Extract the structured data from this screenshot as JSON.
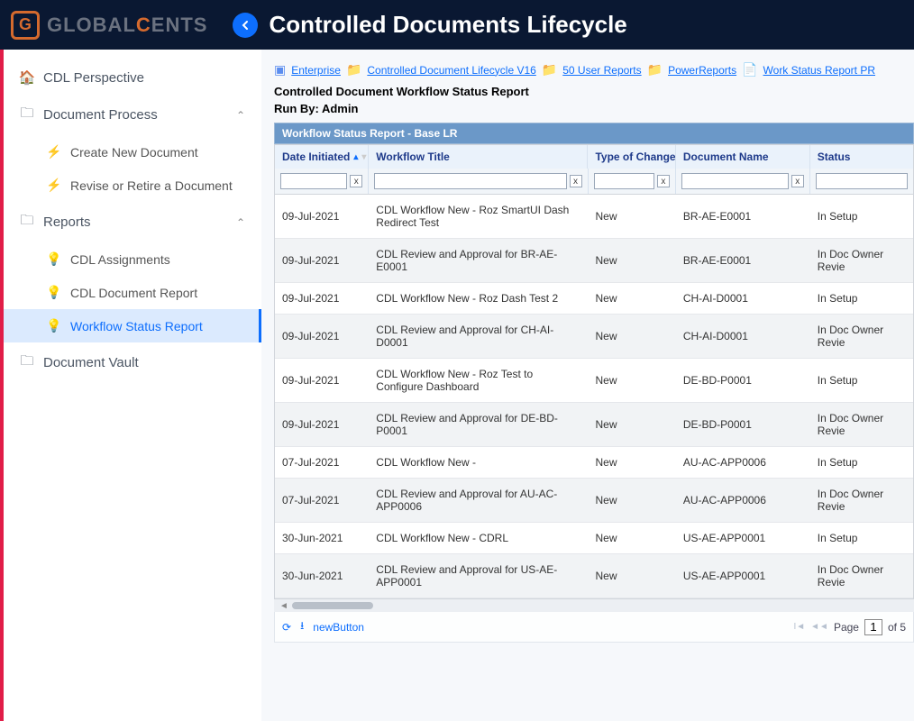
{
  "header": {
    "logo_text_1": "GLOBAL",
    "logo_text_2": "C",
    "logo_text_3": "ENTS",
    "title": "Controlled Documents Lifecycle"
  },
  "sidebar": {
    "items": [
      {
        "label": "CDL Perspective"
      },
      {
        "label": "Document Process"
      },
      {
        "label": "Create New Document"
      },
      {
        "label": "Revise or Retire a Document"
      },
      {
        "label": "Reports"
      },
      {
        "label": "CDL Assignments"
      },
      {
        "label": "CDL Document Report"
      },
      {
        "label": "Workflow Status Report"
      },
      {
        "label": "Document Vault"
      }
    ]
  },
  "breadcrumbs": [
    {
      "label": "Enterprise"
    },
    {
      "label": "Controlled Document Lifecycle V16"
    },
    {
      "label": "50 User Reports"
    },
    {
      "label": "PowerReports"
    },
    {
      "label": "Work Status Report PR"
    }
  ],
  "report": {
    "title": "Controlled Document Workflow Status Report",
    "run_by_label": "Run By: Admin",
    "panel_title": "Workflow Status Report - Base LR"
  },
  "columns": {
    "date": "Date Initiated",
    "wtitle": "Workflow Title",
    "type": "Type of Change",
    "docname": "Document Name",
    "status": "Status"
  },
  "rows": [
    {
      "date": "09-Jul-2021",
      "wtitle": "CDL Workflow New - Roz SmartUI Dash Redirect Test",
      "type": "New",
      "docname": "BR-AE-E0001",
      "status": "In Setup"
    },
    {
      "date": "09-Jul-2021",
      "wtitle": "CDL Review and Approval for BR-AE-E0001",
      "type": "New",
      "docname": "BR-AE-E0001",
      "status": "In Doc Owner Revie"
    },
    {
      "date": "09-Jul-2021",
      "wtitle": "CDL Workflow New - Roz Dash Test 2",
      "type": "New",
      "docname": "CH-AI-D0001",
      "status": "In Setup"
    },
    {
      "date": "09-Jul-2021",
      "wtitle": "CDL Review and Approval for CH-AI-D0001",
      "type": "New",
      "docname": "CH-AI-D0001",
      "status": "In Doc Owner Revie"
    },
    {
      "date": "09-Jul-2021",
      "wtitle": "CDL Workflow New - Roz Test to Configure Dashboard",
      "type": "New",
      "docname": "DE-BD-P0001",
      "status": "In Setup"
    },
    {
      "date": "09-Jul-2021",
      "wtitle": "CDL Review and Approval for DE-BD-P0001",
      "type": "New",
      "docname": "DE-BD-P0001",
      "status": "In Doc Owner Revie"
    },
    {
      "date": "07-Jul-2021",
      "wtitle": "CDL Workflow New -",
      "type": "New",
      "docname": "AU-AC-APP0006",
      "status": "In Setup"
    },
    {
      "date": "07-Jul-2021",
      "wtitle": "CDL Review and Approval for AU-AC-APP0006",
      "type": "New",
      "docname": "AU-AC-APP0006",
      "status": "In Doc Owner Revie"
    },
    {
      "date": "30-Jun-2021",
      "wtitle": "CDL Workflow New - CDRL",
      "type": "New",
      "docname": "US-AE-APP0001",
      "status": "In Setup"
    },
    {
      "date": "30-Jun-2021",
      "wtitle": "CDL Review and Approval for US-AE-APP0001",
      "type": "New",
      "docname": "US-AE-APP0001",
      "status": "In Doc Owner Revie"
    }
  ],
  "footer": {
    "new_button": "newButton",
    "page_label": "Page",
    "page_current": "1",
    "page_total": "of 5"
  }
}
